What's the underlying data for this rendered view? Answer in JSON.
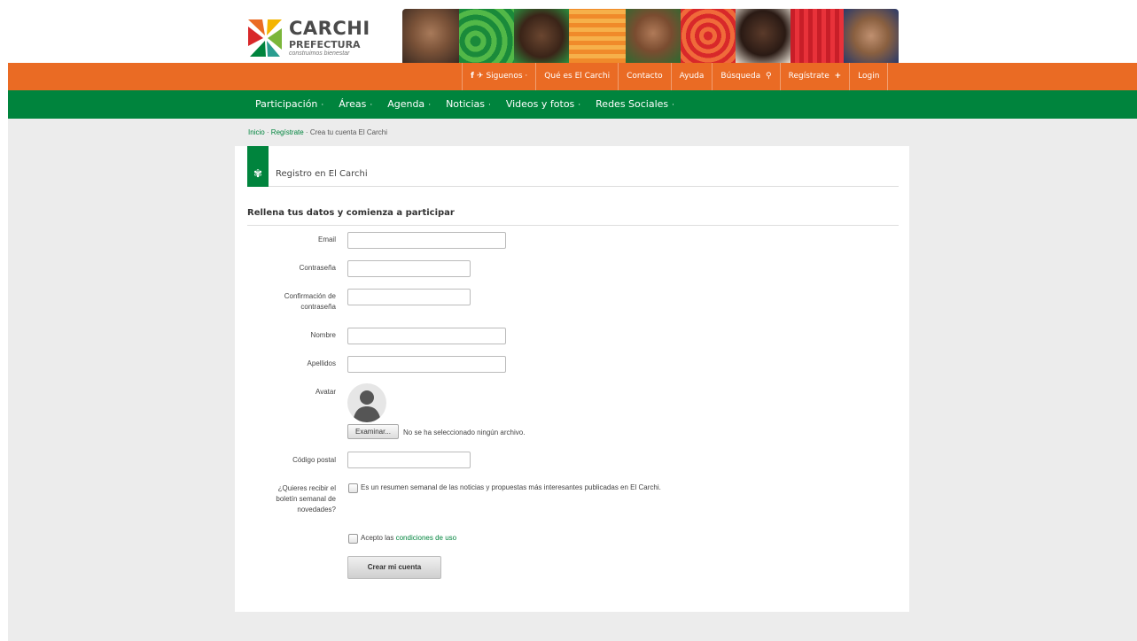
{
  "colors": {
    "orange": "#ea6b24",
    "green": "#00843d"
  },
  "logo": {
    "title": "CARCHI",
    "subtitle": "PREFECTURA",
    "tagline": "construimos bienestar"
  },
  "top_nav": [
    {
      "label": "Siguenos",
      "icon": "facebook-twitter-icon",
      "suffix": "·"
    },
    {
      "label": "Qué es El Carchi"
    },
    {
      "label": "Contacto"
    },
    {
      "label": "Ayuda"
    },
    {
      "label": "Búsqueda",
      "icon": "search-icon"
    },
    {
      "label": "Regístrate",
      "icon": "plus-icon"
    },
    {
      "label": "Login"
    }
  ],
  "main_nav": [
    {
      "label": "Participación",
      "dot": "·"
    },
    {
      "label": "Áreas",
      "dot": "·"
    },
    {
      "label": "Agenda",
      "dot": "·"
    },
    {
      "label": "Noticias",
      "dot": "·"
    },
    {
      "label": "Videos y fotos",
      "dot": "·"
    },
    {
      "label": "Redes Sociales",
      "dot": "·"
    }
  ],
  "breadcrumb": {
    "home": "Inicio",
    "sep": " · ",
    "register": "Regístrate",
    "current": "Crea tu cuenta El Carchi"
  },
  "panel": {
    "title": "Registro en El Carchi",
    "subtitle": "Rellena tus datos y comienza a participar"
  },
  "form": {
    "email_label": "Email",
    "password_label": "Contraseña",
    "confirm_label_1": "Confirmación de",
    "confirm_label_2": "contraseña",
    "name_label": "Nombre",
    "surname_label": "Apellidos",
    "avatar_label": "Avatar",
    "file_button": "Examinar...",
    "file_status": "No se ha seleccionado ningún archivo.",
    "postal_label": "Código postal",
    "newsletter_label_1": "¿Quieres recibir el",
    "newsletter_label_2": "boletín semanal de",
    "newsletter_label_3": "novedades?",
    "newsletter_text": "Es un resumen semanal de las noticias y propuestas más interesantes publicadas en El Carchi.",
    "terms_prefix": "Acepto las",
    "terms_link": "condiciones de uso",
    "submit": "Crear mi cuenta"
  }
}
